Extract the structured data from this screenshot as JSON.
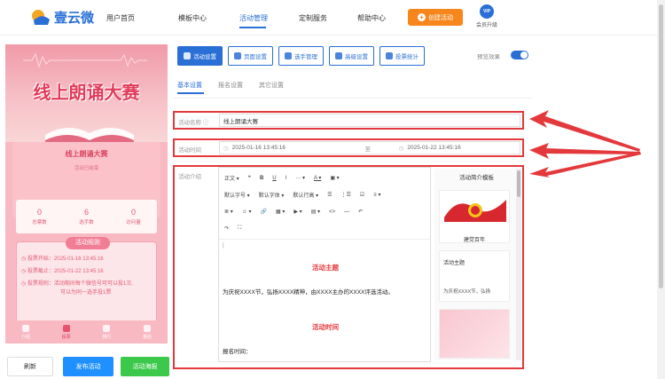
{
  "header": {
    "logo_text": "壹云微",
    "nav": [
      "用户首页",
      "模板中心",
      "活动管理",
      "定制服务",
      "帮助中心"
    ],
    "active_nav": "活动管理",
    "create_button": "创建活动",
    "vip_badge": "VIP",
    "vip_label": "会员升级"
  },
  "preview": {
    "hero_title": "线上朗诵大赛",
    "panel_title": "线上朗诵大赛",
    "panel_subtitle": "活动已结束",
    "stats": [
      {
        "value": "0",
        "label": "总票数"
      },
      {
        "value": "6",
        "label": "选手数"
      },
      {
        "value": "0",
        "label": "访问量"
      }
    ],
    "rules_title": "活动规则",
    "rules": [
      "投票开始：2025-01-16 13:45:16",
      "投票截止：2025-01-22 13:45:16",
      "投票规则：活动期间每个微信号可可以投1次,",
      "可以为同一选手投1票"
    ],
    "tabbar": [
      "介绍",
      "投票",
      "排行",
      "报名"
    ],
    "active_tab": "投票"
  },
  "bottom_buttons": {
    "refresh": "刷新",
    "publish": "发布活动",
    "poster": "活动海报"
  },
  "editor": {
    "tabs": [
      "活动设置",
      "页面设置",
      "选手管理",
      "高级设置",
      "投票统计"
    ],
    "active_tab": "活动设置",
    "preview_effect_label": "预览效果",
    "subtabs": [
      "基本设置",
      "报名设置",
      "其它设置"
    ],
    "active_subtab": "基本设置",
    "name_label": "活动名称",
    "name_value": "线上朗诵大赛",
    "time_label": "活动时间",
    "start_time": "2025-01-16 13:45:16",
    "time_separator": "至",
    "end_time": "2025-01-22 13:45:16",
    "intro_label": "活动介绍",
    "toolbar_row1": [
      "正文",
      "❝",
      "B",
      "U",
      "I",
      "···",
      "A",
      "▣"
    ],
    "toolbar_row2": [
      "默认字号",
      "默认字体",
      "默认行高",
      "☰",
      "⋮☰",
      "☑",
      "≡"
    ],
    "toolbar_row3": [
      "≣",
      "☺",
      "🔗",
      "▦",
      "▶",
      "▤",
      "<>",
      "—",
      "↶"
    ],
    "toolbar_row4": [
      "↷",
      "⛶"
    ],
    "content": {
      "cursor": "|",
      "heading1": "活动主题",
      "paragraph1": "为庆祝XXXX节，弘扬XXXX精神，由XXXX主办的XXXX评选活动。",
      "heading2": "活动时间",
      "paragraph2": "报名时间："
    },
    "template_panel": {
      "title": "活动简介模板",
      "card1_caption": "建党百年",
      "card2_heading": "活动主题",
      "card2_text": "为庆祝XXXX节，弘扬"
    }
  },
  "colors": {
    "brand": "#2a6fd6",
    "accent_orange": "#f7861c",
    "highlight_red": "#e4393c",
    "pink": "#f8b9c3",
    "publish": "#1e90ff",
    "poster": "#3cc84a"
  }
}
